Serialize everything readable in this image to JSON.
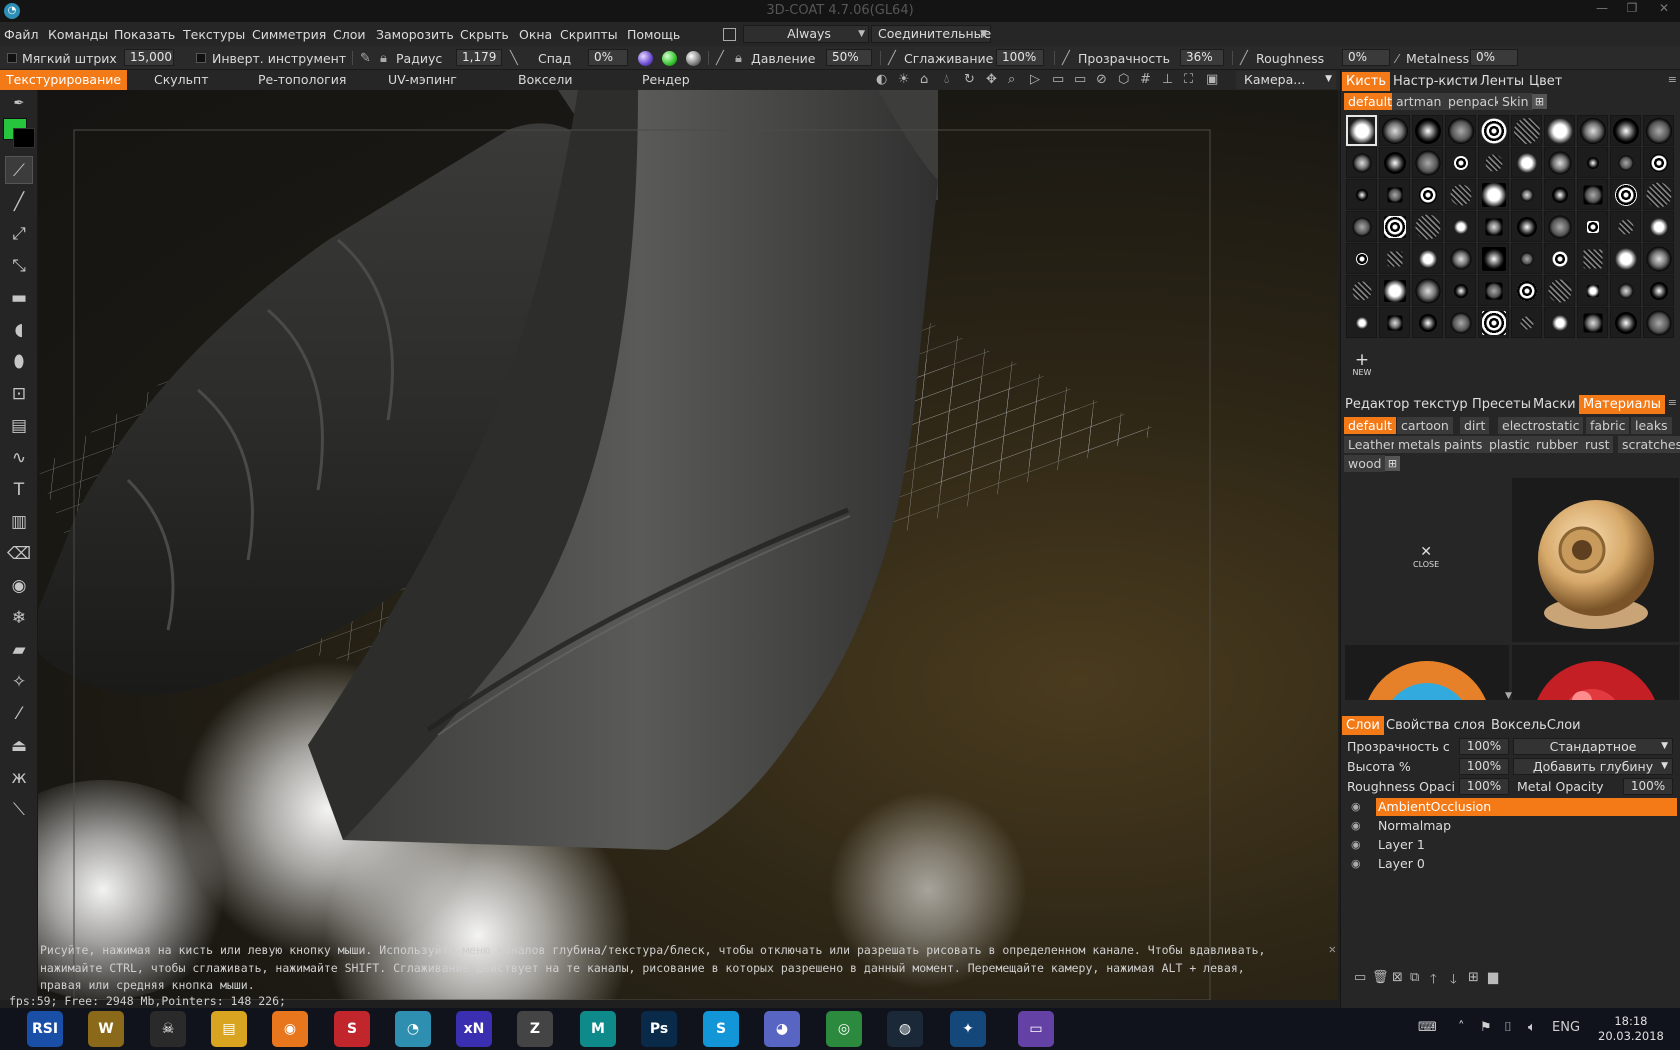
{
  "window": {
    "title": "3D-COAT 4.7.06(GL64)",
    "logo": "3dcoat-logo-icon"
  },
  "menu": [
    "Файл",
    "Команды",
    "Показать",
    "Текстуры",
    "Симметрия",
    "Слои",
    "Заморозить",
    "Скрыть",
    "Окна",
    "Скрипты",
    "Помощь"
  ],
  "menu_combos": {
    "always": "Always",
    "connectivity": "Соединительные"
  },
  "toolbar": {
    "soft_stroke_label": "Мягкий штрих",
    "soft_stroke_value": "15,000",
    "invert_tool_label": "Инверт. инструмент",
    "radius_label": "Радиус",
    "radius_value": "1,179",
    "falloff_label": "Спад",
    "falloff_value": "0%",
    "pressure_label": "Давление",
    "pressure_value": "50%",
    "smoothing_label": "Сглаживание",
    "smoothing_value": "100%",
    "transparency_label": "Прозрачность",
    "transparency_value": "36%",
    "roughness_label": "Roughness",
    "roughness_value": "0%",
    "metalness_label": "Metalness",
    "metalness_value": "0%"
  },
  "rooms": [
    "Текстурирование",
    "Скульпт",
    "Ре-топология",
    "UV-мэпинг",
    "Воксели",
    "Рендер"
  ],
  "camera_combo": "Камера...",
  "brush_panel": {
    "tabs": [
      "Кисть",
      "Настр-кисти",
      "Ленты",
      "Цвет"
    ],
    "tags": [
      "default",
      "artman",
      "penpack",
      "Skin"
    ],
    "new_label": "NEW"
  },
  "materials_panel": {
    "tabs": [
      "Редактор текстур",
      "Пресеты",
      "Маски",
      "Материалы"
    ],
    "tags": [
      "default",
      "cartoon",
      "dirt",
      "electrostatic",
      "fabric",
      "leaks",
      "Leather",
      "metals",
      "paints",
      "plastic",
      "rubber",
      "rust",
      "scratches",
      "wood"
    ],
    "close_label": "CLOSE"
  },
  "layers_panel": {
    "tabs": [
      "Слои",
      "Свойства слоя",
      "ВоксельСлои"
    ],
    "opacity_label": "Прозрачность с",
    "opacity_value": "100%",
    "blend_mode": "Стандартное",
    "height_label": "Высота %",
    "height_value": "100%",
    "depth_mode": "Добавить глубину",
    "roughness_opacity_label": "Roughness Opaci",
    "roughness_opacity_value": "100%",
    "metal_opacity_label": "Metal Opacity",
    "metal_opacity_value": "100%",
    "layers": [
      "AmbientOcclusion",
      "Normalmap",
      "Layer 1",
      "Layer 0"
    ]
  },
  "hint": {
    "line1": "Рисуйте, нажимая на кисть или левую кнопку мыши. Используйте меню каналов глубина/текстура/блеск, чтобы отключать или разрешать рисовать в определенном канале. Чтобы вдавливать,",
    "line2": "нажимайте CTRL, чтобы сглаживать, нажимайте SHIFT. Сглаживание действует на те каналы, рисование в которых разрешено в данный момент. Перемещайте камеру, нажимая ALT + левая,",
    "line3": "правая или средняя кнопка мыши."
  },
  "status": "fps:59;   Free: 2948 Mb,Pointers: 148 226;",
  "taskbar": {
    "lang": "ENG",
    "time": "18:18",
    "date": "20.03.2018",
    "apps": [
      {
        "icon": "rsi-icon",
        "label": "RSI",
        "color": "#1a4fa8"
      },
      {
        "icon": "wow-icon",
        "label": "W",
        "color": "#8a6a1a"
      },
      {
        "icon": "skull-app-icon",
        "label": "☠",
        "color": "#2a2a2a"
      },
      {
        "icon": "file-explorer-icon",
        "label": "▤",
        "color": "#d9a520"
      },
      {
        "icon": "blender-icon",
        "label": "◉",
        "color": "#e8761c"
      },
      {
        "icon": "steelseries-icon",
        "label": "S",
        "color": "#c0262b"
      },
      {
        "icon": "3dcoat-taskbar-icon",
        "label": "◔",
        "color": "#2f8fb0"
      },
      {
        "icon": "xnview-icon",
        "label": "xN",
        "color": "#3a2fb0"
      },
      {
        "icon": "zbrush-icon",
        "label": "Z",
        "color": "#444"
      },
      {
        "icon": "3dsmax-icon",
        "label": "M",
        "color": "#0f8a8a"
      },
      {
        "icon": "photoshop-icon",
        "label": "Ps",
        "color": "#0a2a4a"
      },
      {
        "icon": "skype-icon",
        "label": "S",
        "color": "#1296d8"
      },
      {
        "icon": "discord-icon",
        "label": "◕",
        "color": "#5865c2"
      },
      {
        "icon": "chrome-icon",
        "label": "◎",
        "color": "#2b8a3e"
      },
      {
        "icon": "steam-icon",
        "label": "◍",
        "color": "#1b2838"
      },
      {
        "icon": "battlenet-icon",
        "label": "✦",
        "color": "#14477a"
      },
      {
        "icon": "twitch-icon",
        "label": "▭",
        "color": "#6441a5"
      }
    ]
  },
  "colors": {
    "accent": "#f47a17",
    "primary_color": "#27c53e",
    "secondary_color": "#000000"
  }
}
